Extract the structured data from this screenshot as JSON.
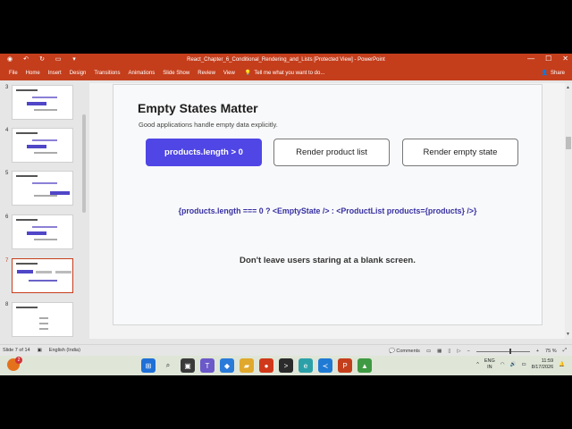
{
  "window": {
    "title": "React_Chapter_6_Conditional_Rendering_and_Lists [Protected View] - PowerPoint",
    "controls": {
      "minimize": "—",
      "maximize": "☐",
      "close": "✕"
    }
  },
  "ribbon": {
    "tabs": [
      "File",
      "Home",
      "Insert",
      "Design",
      "Transitions",
      "Animations",
      "Slide Show",
      "Review",
      "View"
    ],
    "tell_me": "Tell me what you want to do...",
    "share": "Share"
  },
  "thumbnails": [
    {
      "number": "3",
      "active": false
    },
    {
      "number": "4",
      "active": false
    },
    {
      "number": "5",
      "active": false
    },
    {
      "number": "6",
      "active": false
    },
    {
      "number": "7",
      "active": true
    },
    {
      "number": "8",
      "active": false
    }
  ],
  "slide": {
    "title": "Empty States Matter",
    "subtitle": "Good applications handle empty data explicitly.",
    "boxes": [
      "products.length > 0",
      "Render product list",
      "Render empty state"
    ],
    "code": "{products.length === 0 ? <EmptyState /> : <ProductList products={products} />}",
    "note": "Don't leave users staring at a blank screen."
  },
  "statusbar": {
    "slide_info": "Slide 7 of 14",
    "language": "English (India)",
    "comments": "Comments",
    "zoom": "75 %",
    "zoom_level_percent": 75
  },
  "taskbar": {
    "notification_count": "2",
    "lang_top": "ENG",
    "lang_bottom": "IN",
    "time": "11:59",
    "date": "8/17/2026"
  }
}
